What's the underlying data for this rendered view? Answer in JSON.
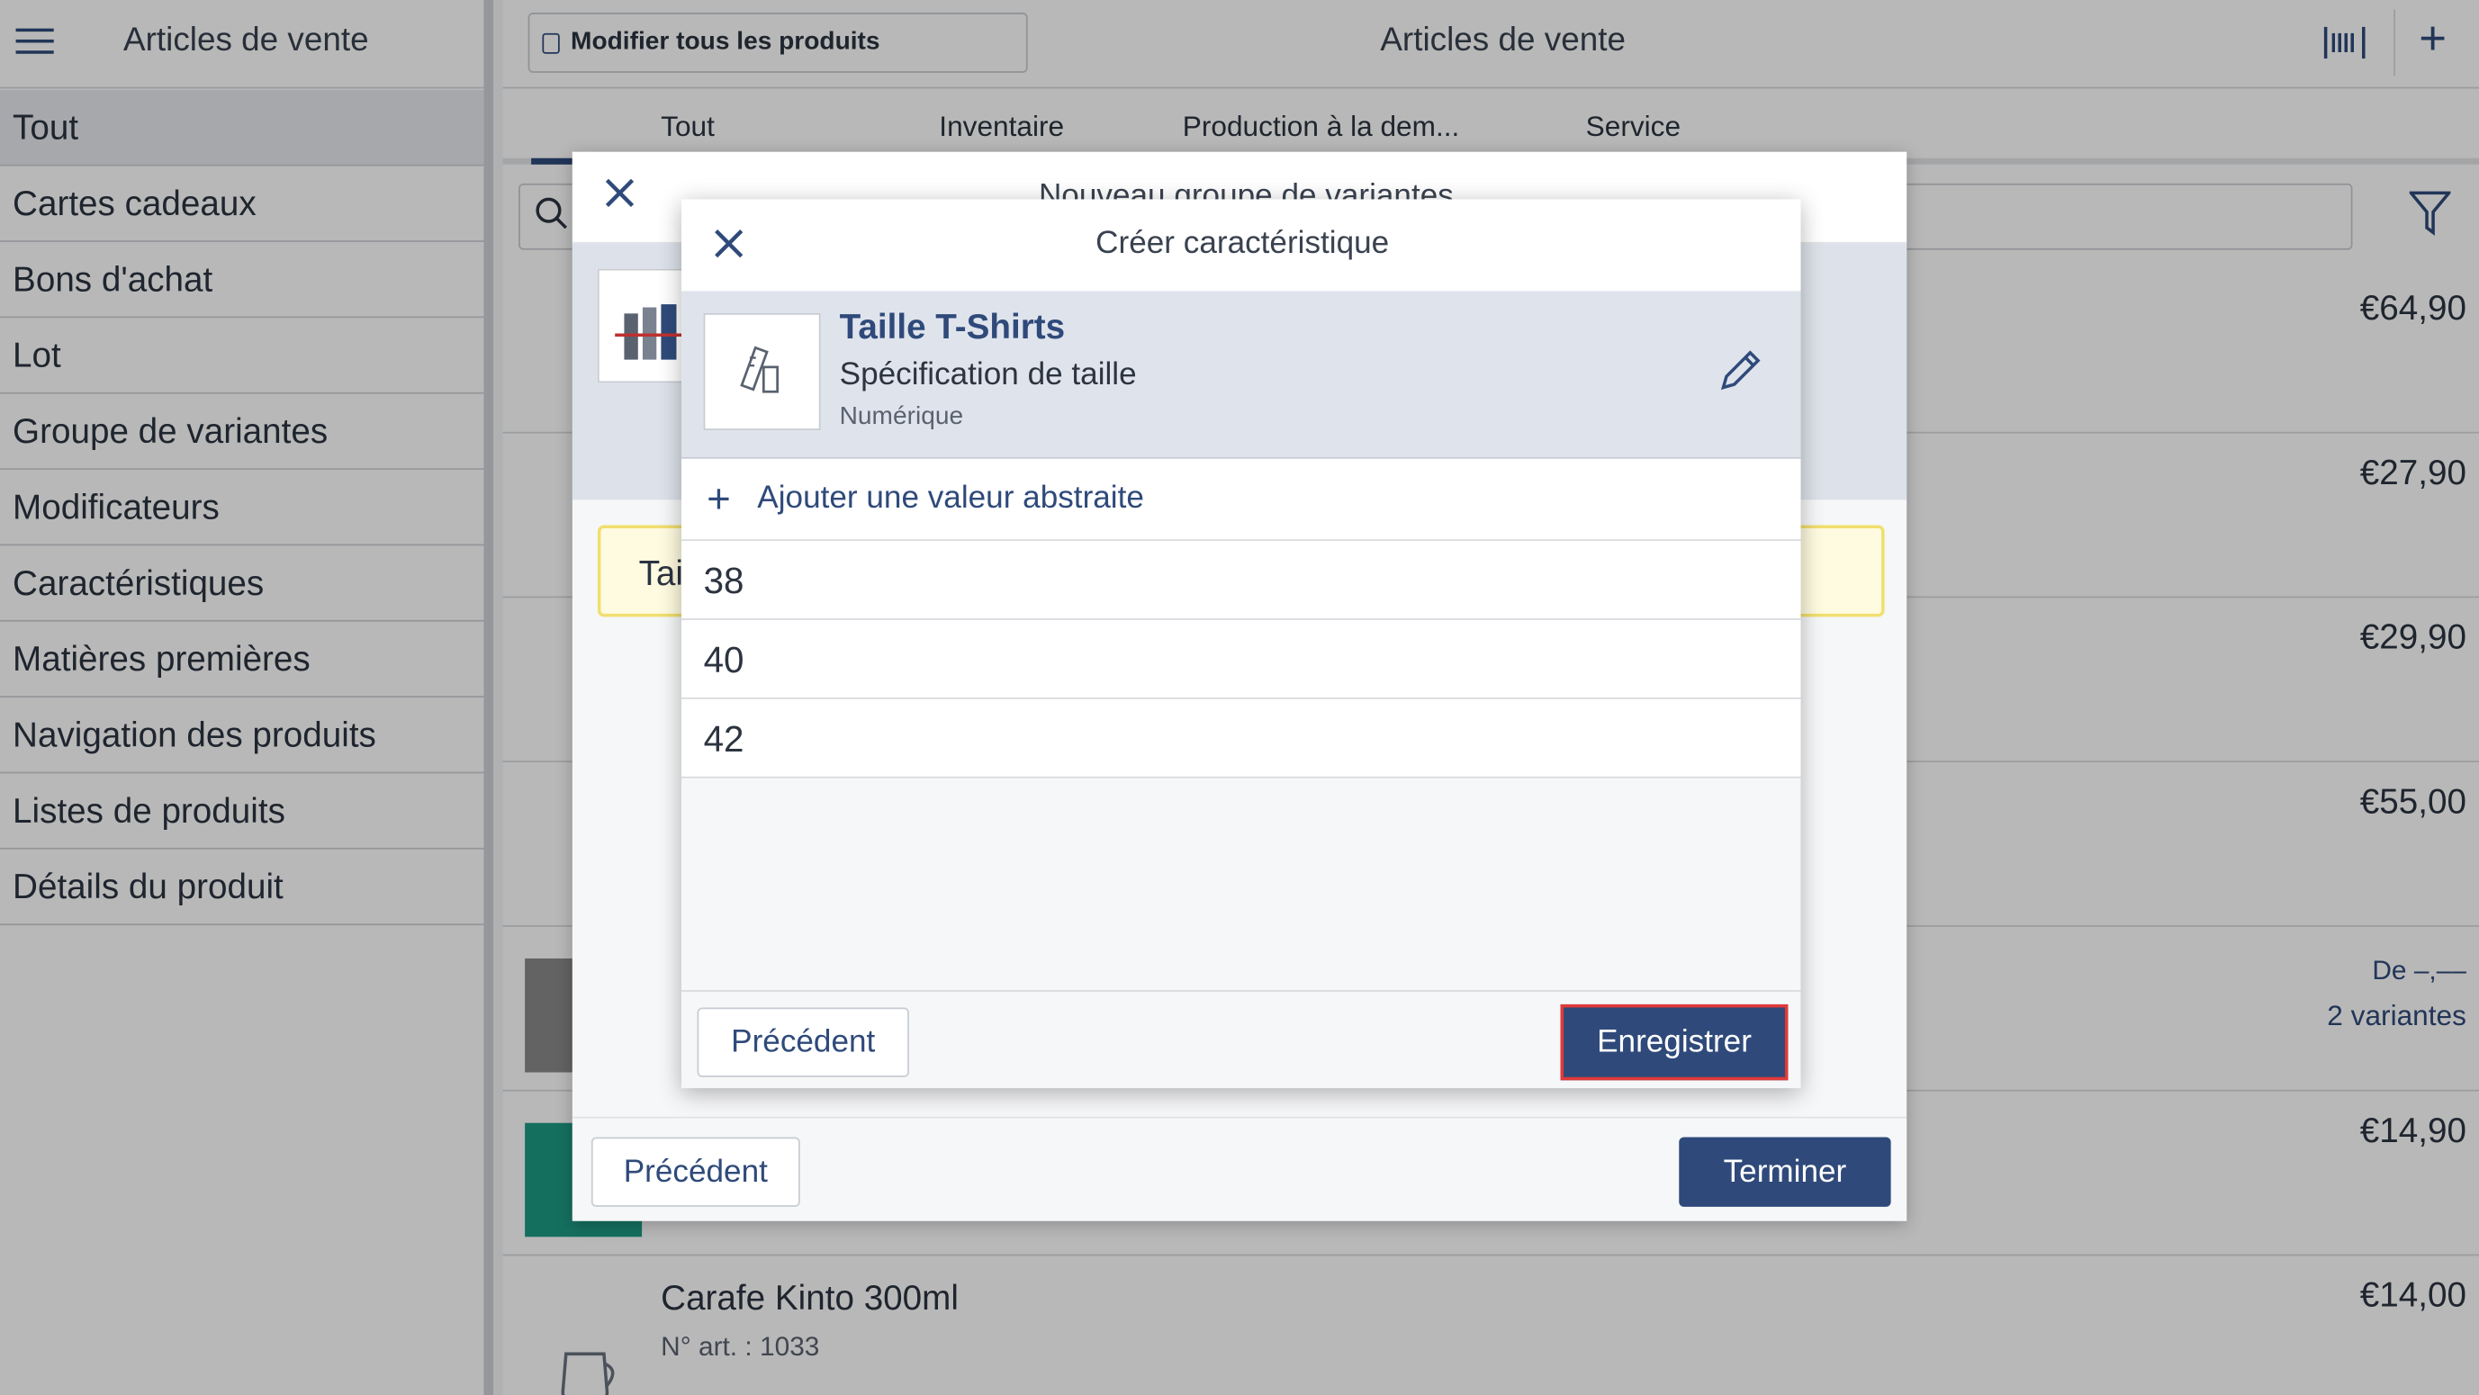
{
  "sidebar": {
    "title": "Articles de vente",
    "items": [
      {
        "label": "Tout"
      },
      {
        "label": "Cartes cadeaux"
      },
      {
        "label": "Bons d'achat"
      },
      {
        "label": "Lot"
      },
      {
        "label": "Groupe de variantes"
      },
      {
        "label": "Modificateurs"
      },
      {
        "label": "Caractéristiques"
      },
      {
        "label": "Matières premières"
      },
      {
        "label": "Navigation des produits"
      },
      {
        "label": "Listes de produits"
      },
      {
        "label": "Détails du produit"
      }
    ]
  },
  "header": {
    "modify_all": "Modifier tous les produits",
    "title": "Articles de vente"
  },
  "tabs": [
    {
      "label": "Tout"
    },
    {
      "label": "Inventaire"
    },
    {
      "label": "Production à la dem..."
    },
    {
      "label": "Service"
    }
  ],
  "products": [
    {
      "price": "€64,90"
    },
    {
      "price": "€27,90"
    },
    {
      "price": "€29,90"
    },
    {
      "price": "€55,00"
    },
    {
      "price_from": "De –,––",
      "variants": "2 variantes"
    },
    {
      "price": "€14,90"
    },
    {
      "name": "Carafe Kinto 300ml",
      "art": "N° art. : 1033",
      "price": "€14,00"
    }
  ],
  "back_modal": {
    "title": "Nouveau groupe de variantes",
    "yellow_text": "Tai",
    "prev": "Précédent",
    "finish": "Terminer"
  },
  "front_modal": {
    "title": "Créer caractéristique",
    "card": {
      "name": "Taille T-Shirts",
      "subtitle": "Spécification de taille",
      "type": "Numérique"
    },
    "add_value": "Ajouter une valeur abstraite",
    "values": [
      "38",
      "40",
      "42"
    ],
    "prev": "Précédent",
    "save": "Enregistrer"
  },
  "colors": {
    "accent": "#2f4a7a",
    "highlight_border": "#e03a3a",
    "warning_bg": "#fffbe0"
  }
}
